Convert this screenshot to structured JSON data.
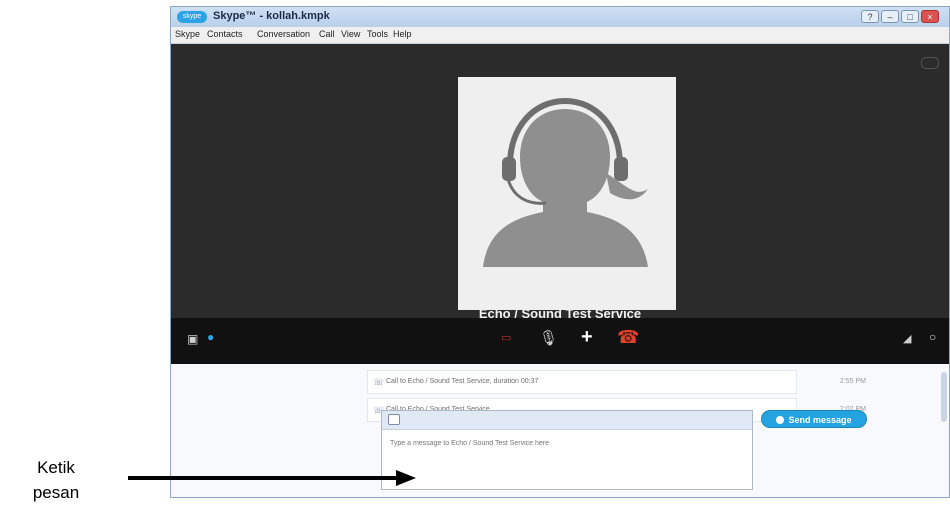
{
  "window": {
    "logo": "skype",
    "title": "Skype™ - kollah.kmpk",
    "buttons": [
      "?",
      "–",
      "□",
      "×"
    ]
  },
  "menu": [
    "Skype",
    "Contacts",
    "Conversation",
    "Call",
    "View",
    "Tools",
    "Help"
  ],
  "call": {
    "caller_name": "Echo / Sound Test Service"
  },
  "controls": {
    "left_icons": [
      "contacts-icon",
      "chat-icon"
    ],
    "center_icons": [
      "video-icon",
      "microphone-icon",
      "add-icon",
      "hangup-icon"
    ],
    "right_icons": [
      "signal-icon",
      "settings-icon"
    ]
  },
  "history": [
    {
      "text": "Call to Echo / Sound Test Service, duration 00:37",
      "time": "2:55 PM"
    },
    {
      "text": "Call to Echo / Sound Test Service",
      "time": "2:02 PM"
    }
  ],
  "composer": {
    "placeholder": "Type a message to Echo / Sound Test Service here",
    "send_label": "Send message"
  },
  "annotation": {
    "line1": "Ketik",
    "line2": "pesan"
  },
  "colors": {
    "accent": "#23a3e0",
    "hangup": "#e0412b",
    "call_bg": "#2b2b2b"
  }
}
